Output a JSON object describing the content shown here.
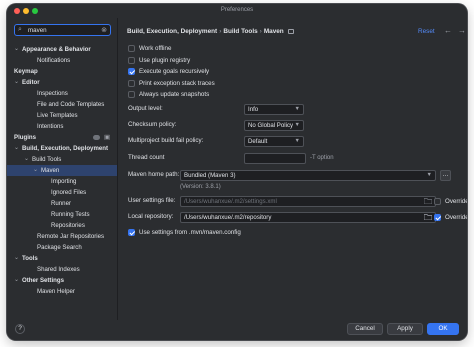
{
  "window": {
    "title": "Preferences"
  },
  "search": {
    "value": "maven"
  },
  "sidebar": {
    "items": [
      {
        "label": "Appearance & Behavior",
        "bold": true,
        "chevron": "open"
      },
      {
        "label": "Notifications"
      },
      {
        "label": "Keymap",
        "bold": true
      },
      {
        "label": "Editor",
        "bold": true,
        "chevron": "open"
      },
      {
        "label": "Inspections"
      },
      {
        "label": "File and Code Templates"
      },
      {
        "label": "Live Templates"
      },
      {
        "label": "Intentions"
      },
      {
        "label": "Plugins",
        "bold": true,
        "badge": "plugins-badge-icon"
      },
      {
        "label": "Build, Execution, Deployment",
        "bold": true,
        "chevron": "open"
      },
      {
        "label": "Build Tools",
        "chevron": "open"
      },
      {
        "label": "Maven",
        "chevron": "open",
        "selected": true
      },
      {
        "label": "Importing"
      },
      {
        "label": "Ignored Files"
      },
      {
        "label": "Runner"
      },
      {
        "label": "Running Tests"
      },
      {
        "label": "Repositories"
      },
      {
        "label": "Remote Jar Repositories"
      },
      {
        "label": "Package Search"
      },
      {
        "label": "Tools",
        "bold": true,
        "chevron": "open"
      },
      {
        "label": "Shared Indexes"
      },
      {
        "label": "Other Settings",
        "bold": true,
        "chevron": "open"
      },
      {
        "label": "Maven Helper"
      }
    ]
  },
  "breadcrumb": {
    "items": [
      "Build, Execution, Deployment",
      "Build Tools",
      "Maven"
    ],
    "separator": "›"
  },
  "header": {
    "reset_label": "Reset",
    "back_icon": "arrow-left-icon",
    "forward_icon": "arrow-right-icon"
  },
  "options": [
    {
      "label": "Work offline",
      "checked": false
    },
    {
      "label": "Use plugin registry",
      "checked": false
    },
    {
      "label": "Execute goals recursively",
      "checked": true
    },
    {
      "label": "Print exception stack traces",
      "checked": false
    },
    {
      "label": "Always update snapshots",
      "checked": false
    }
  ],
  "fields": {
    "output_level": {
      "label": "Output level:",
      "value": "Info"
    },
    "checksum_policy": {
      "label": "Checksum policy:",
      "value": "No Global Policy"
    },
    "fail_policy": {
      "label": "Multiproject build fail policy:",
      "value": "Default"
    },
    "thread_count": {
      "label": "Thread count",
      "value": "",
      "hint": "-T option"
    },
    "maven_home": {
      "label": "Maven home path:",
      "value": "Bundled (Maven 3)",
      "version": "(Version: 3.8.1)"
    },
    "settings_file": {
      "label": "User settings file:",
      "value": "/Users/wuhanxue/.m2/settings.xml",
      "override_label": "Override",
      "override_checked": false
    },
    "local_repo": {
      "label": "Local repository:",
      "value": "/Users/wuhanxue/.m2/repository",
      "override_label": "Override",
      "override_checked": true
    },
    "use_settings": {
      "label": "Use settings from .mvn/maven.config",
      "checked": true
    }
  },
  "footer": {
    "help_label": "?",
    "cancel_label": "Cancel",
    "apply_label": "Apply",
    "ok_label": "OK"
  },
  "colors": {
    "accent": "#3574f0",
    "window_bg": "#2b2d30",
    "selection": "#2e436e"
  }
}
